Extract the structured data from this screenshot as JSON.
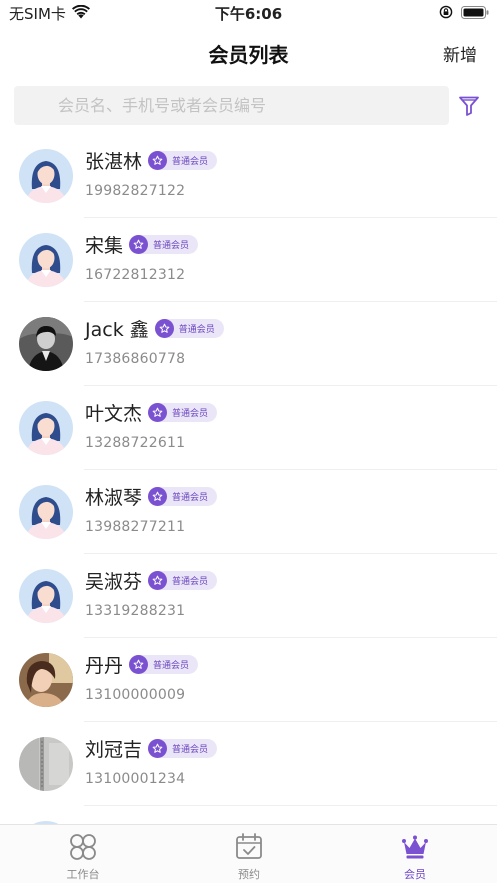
{
  "status_bar": {
    "carrier": "无SIM卡",
    "time": "下午6:06",
    "icons": [
      "wifi-icon",
      "rotation-lock-icon",
      "battery-icon"
    ]
  },
  "nav": {
    "title": "会员列表",
    "add_label": "新增"
  },
  "search": {
    "placeholder": "会员名、手机号或者会员编号",
    "filter_icon": "filter-icon"
  },
  "badge_color": "#7a52d1",
  "members": [
    {
      "name": "张湛林",
      "badge": "普通会员",
      "phone": "19982827122",
      "avatar": "default-avatar"
    },
    {
      "name": "宋集",
      "badge": "普通会员",
      "phone": "16722812312",
      "avatar": "default-avatar"
    },
    {
      "name": "Jack 鑫",
      "badge": "普通会员",
      "phone": "17386860778",
      "avatar": "photo-avatar-dark"
    },
    {
      "name": "叶文杰",
      "badge": "普通会员",
      "phone": "13288722611",
      "avatar": "default-avatar"
    },
    {
      "name": "林淑琴",
      "badge": "普通会员",
      "phone": "13988277211",
      "avatar": "default-avatar"
    },
    {
      "name": "吴淑芬",
      "badge": "普通会员",
      "phone": "13319288231",
      "avatar": "default-avatar"
    },
    {
      "name": "丹丹",
      "badge": "普通会员",
      "phone": "13100000009",
      "avatar": "photo-avatar-warm"
    },
    {
      "name": "刘冠吉",
      "badge": "普通会员",
      "phone": "13100001234",
      "avatar": "photo-avatar-gray"
    }
  ],
  "tabs": [
    {
      "label": "工作台",
      "icon": "grid-icon",
      "active": false
    },
    {
      "label": "预约",
      "icon": "calendar-icon",
      "active": false
    },
    {
      "label": "会员",
      "icon": "crown-icon",
      "active": true
    }
  ]
}
